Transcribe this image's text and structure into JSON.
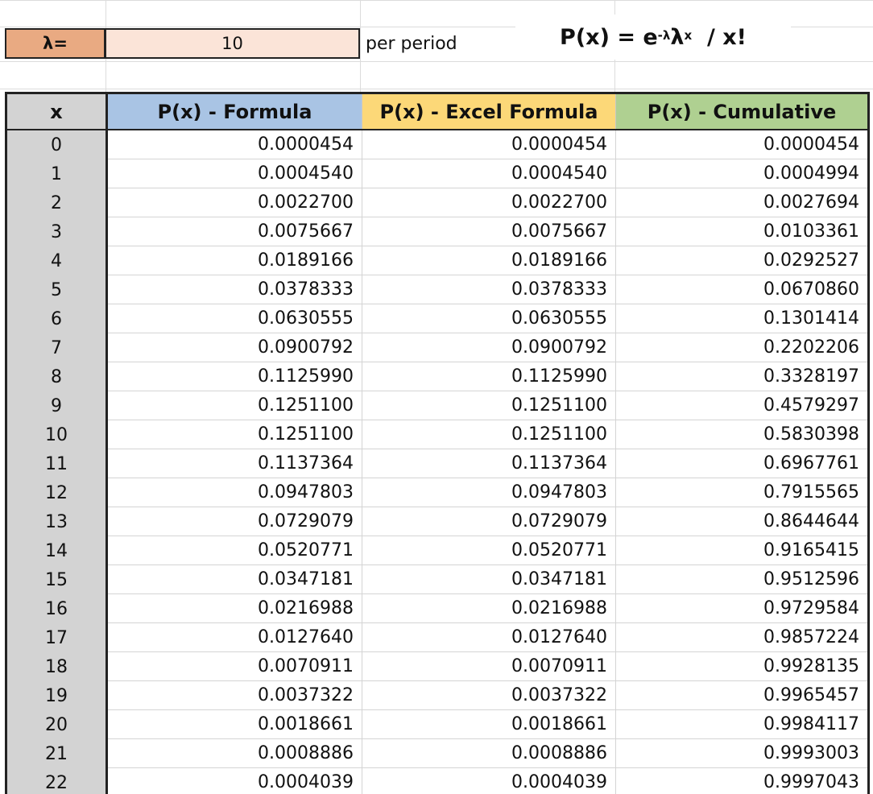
{
  "inputs": {
    "lambda_label": "λ=",
    "lambda_value": "10",
    "unit_label": "per period"
  },
  "formula": {
    "lhs": "P(x) = e",
    "exp1": "-λ",
    "mid": " λ",
    "exp2": "x",
    "rhs": "  / x!"
  },
  "colors": {
    "lambda_label_bg": "#e9aa82",
    "lambda_value_bg": "#fbe4d8",
    "header_x_bg": "#d3d3d3",
    "header_formula_bg": "#a9c4e4",
    "header_excel_bg": "#fcd878",
    "header_cumulative_bg": "#afd091"
  },
  "table": {
    "headers": [
      "x",
      "P(x) - Formula",
      "P(x) - Excel Formula",
      "P(x) - Cumulative"
    ],
    "rows": [
      [
        "0",
        "0.0000454",
        "0.0000454",
        "0.0000454"
      ],
      [
        "1",
        "0.0004540",
        "0.0004540",
        "0.0004994"
      ],
      [
        "2",
        "0.0022700",
        "0.0022700",
        "0.0027694"
      ],
      [
        "3",
        "0.0075667",
        "0.0075667",
        "0.0103361"
      ],
      [
        "4",
        "0.0189166",
        "0.0189166",
        "0.0292527"
      ],
      [
        "5",
        "0.0378333",
        "0.0378333",
        "0.0670860"
      ],
      [
        "6",
        "0.0630555",
        "0.0630555",
        "0.1301414"
      ],
      [
        "7",
        "0.0900792",
        "0.0900792",
        "0.2202206"
      ],
      [
        "8",
        "0.1125990",
        "0.1125990",
        "0.3328197"
      ],
      [
        "9",
        "0.1251100",
        "0.1251100",
        "0.4579297"
      ],
      [
        "10",
        "0.1251100",
        "0.1251100",
        "0.5830398"
      ],
      [
        "11",
        "0.1137364",
        "0.1137364",
        "0.6967761"
      ],
      [
        "12",
        "0.0947803",
        "0.0947803",
        "0.7915565"
      ],
      [
        "13",
        "0.0729079",
        "0.0729079",
        "0.8644644"
      ],
      [
        "14",
        "0.0520771",
        "0.0520771",
        "0.9165415"
      ],
      [
        "15",
        "0.0347181",
        "0.0347181",
        "0.9512596"
      ],
      [
        "16",
        "0.0216988",
        "0.0216988",
        "0.9729584"
      ],
      [
        "17",
        "0.0127640",
        "0.0127640",
        "0.9857224"
      ],
      [
        "18",
        "0.0070911",
        "0.0070911",
        "0.9928135"
      ],
      [
        "19",
        "0.0037322",
        "0.0037322",
        "0.9965457"
      ],
      [
        "20",
        "0.0018661",
        "0.0018661",
        "0.9984117"
      ],
      [
        "21",
        "0.0008886",
        "0.0008886",
        "0.9993003"
      ],
      [
        "22",
        "0.0004039",
        "0.0004039",
        "0.9997043"
      ]
    ]
  }
}
